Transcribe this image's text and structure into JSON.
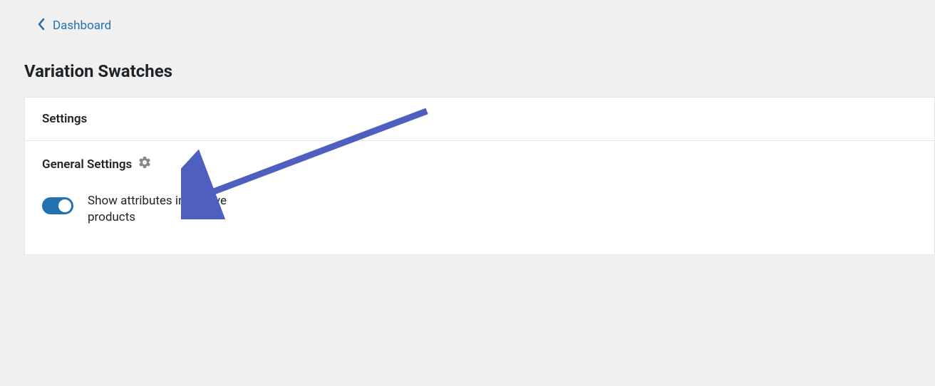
{
  "breadcrumb": {
    "label": "Dashboard"
  },
  "page": {
    "title": "Variation Swatches"
  },
  "card": {
    "header": "Settings",
    "section_title": "General Settings"
  },
  "settings": {
    "show_attributes_label": "Show attributes in archive products",
    "show_attributes_enabled": true
  },
  "colors": {
    "accent": "#2271b1",
    "arrow": "#4f5fbf"
  }
}
